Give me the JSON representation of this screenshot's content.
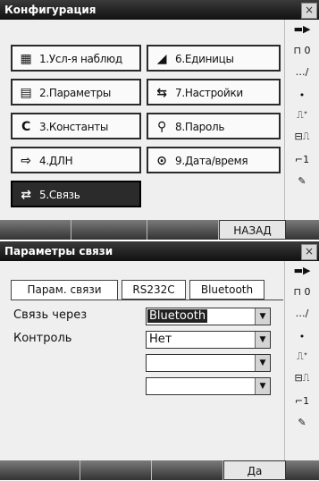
{
  "window1": {
    "title": "Конфигурация",
    "close": "×",
    "menu": [
      {
        "icon": "▦",
        "icon_name": "survey-grid-icon",
        "label": "1.Усл-я наблюд"
      },
      {
        "icon": "▤",
        "icon_name": "parameters-icon",
        "label": "2.Параметры"
      },
      {
        "icon": "C",
        "icon_name": "constants-icon",
        "label": "3.Константы"
      },
      {
        "icon": "⇨",
        "icon_name": "edm-icon",
        "label": "4.ДЛН"
      },
      {
        "icon": "⇄",
        "icon_name": "communication-icon",
        "label": "5.Связь"
      },
      {
        "icon": "◢",
        "icon_name": "units-icon",
        "label": "6.Единицы"
      },
      {
        "icon": "⇆",
        "icon_name": "settings-icon",
        "label": "7.Настройки"
      },
      {
        "icon": "⚲",
        "icon_name": "key-icon",
        "label": "8.Пароль"
      },
      {
        "icon": "⊙",
        "icon_name": "clock-icon",
        "label": "9.Дата/время"
      }
    ],
    "softkeys": [
      "",
      "",
      "",
      "НАЗАД"
    ]
  },
  "window2": {
    "title": "Параметры связи",
    "close": "×",
    "tabs": [
      "Парам. связи",
      "RS232C",
      "Bluetooth"
    ],
    "fields": [
      {
        "label": "Связь через",
        "value": "Bluetooth",
        "highlighted": true
      },
      {
        "label": "Контроль",
        "value": "Нет",
        "highlighted": false
      },
      {
        "label": "",
        "value": "",
        "highlighted": false
      },
      {
        "label": "",
        "value": "",
        "highlighted": false
      }
    ],
    "combo_arrow": "▼",
    "softkeys": [
      "",
      "",
      "",
      "Да"
    ]
  },
  "status_icons": [
    {
      "glyph": "▬▶",
      "name": "battery-icon"
    },
    {
      "glyph": "⊓ 0",
      "name": "tilt-compensation-icon"
    },
    {
      "glyph": "…∕",
      "name": "signal-icon"
    },
    {
      "glyph": "•",
      "name": "dot-icon"
    },
    {
      "glyph": "⎍ᐩ",
      "name": "target-icon"
    },
    {
      "glyph": "⊟⎍",
      "name": "memory-icon"
    },
    {
      "glyph": "⌐1",
      "name": "page-indicator-icon"
    },
    {
      "glyph": "✎",
      "name": "pen-input-icon"
    }
  ]
}
